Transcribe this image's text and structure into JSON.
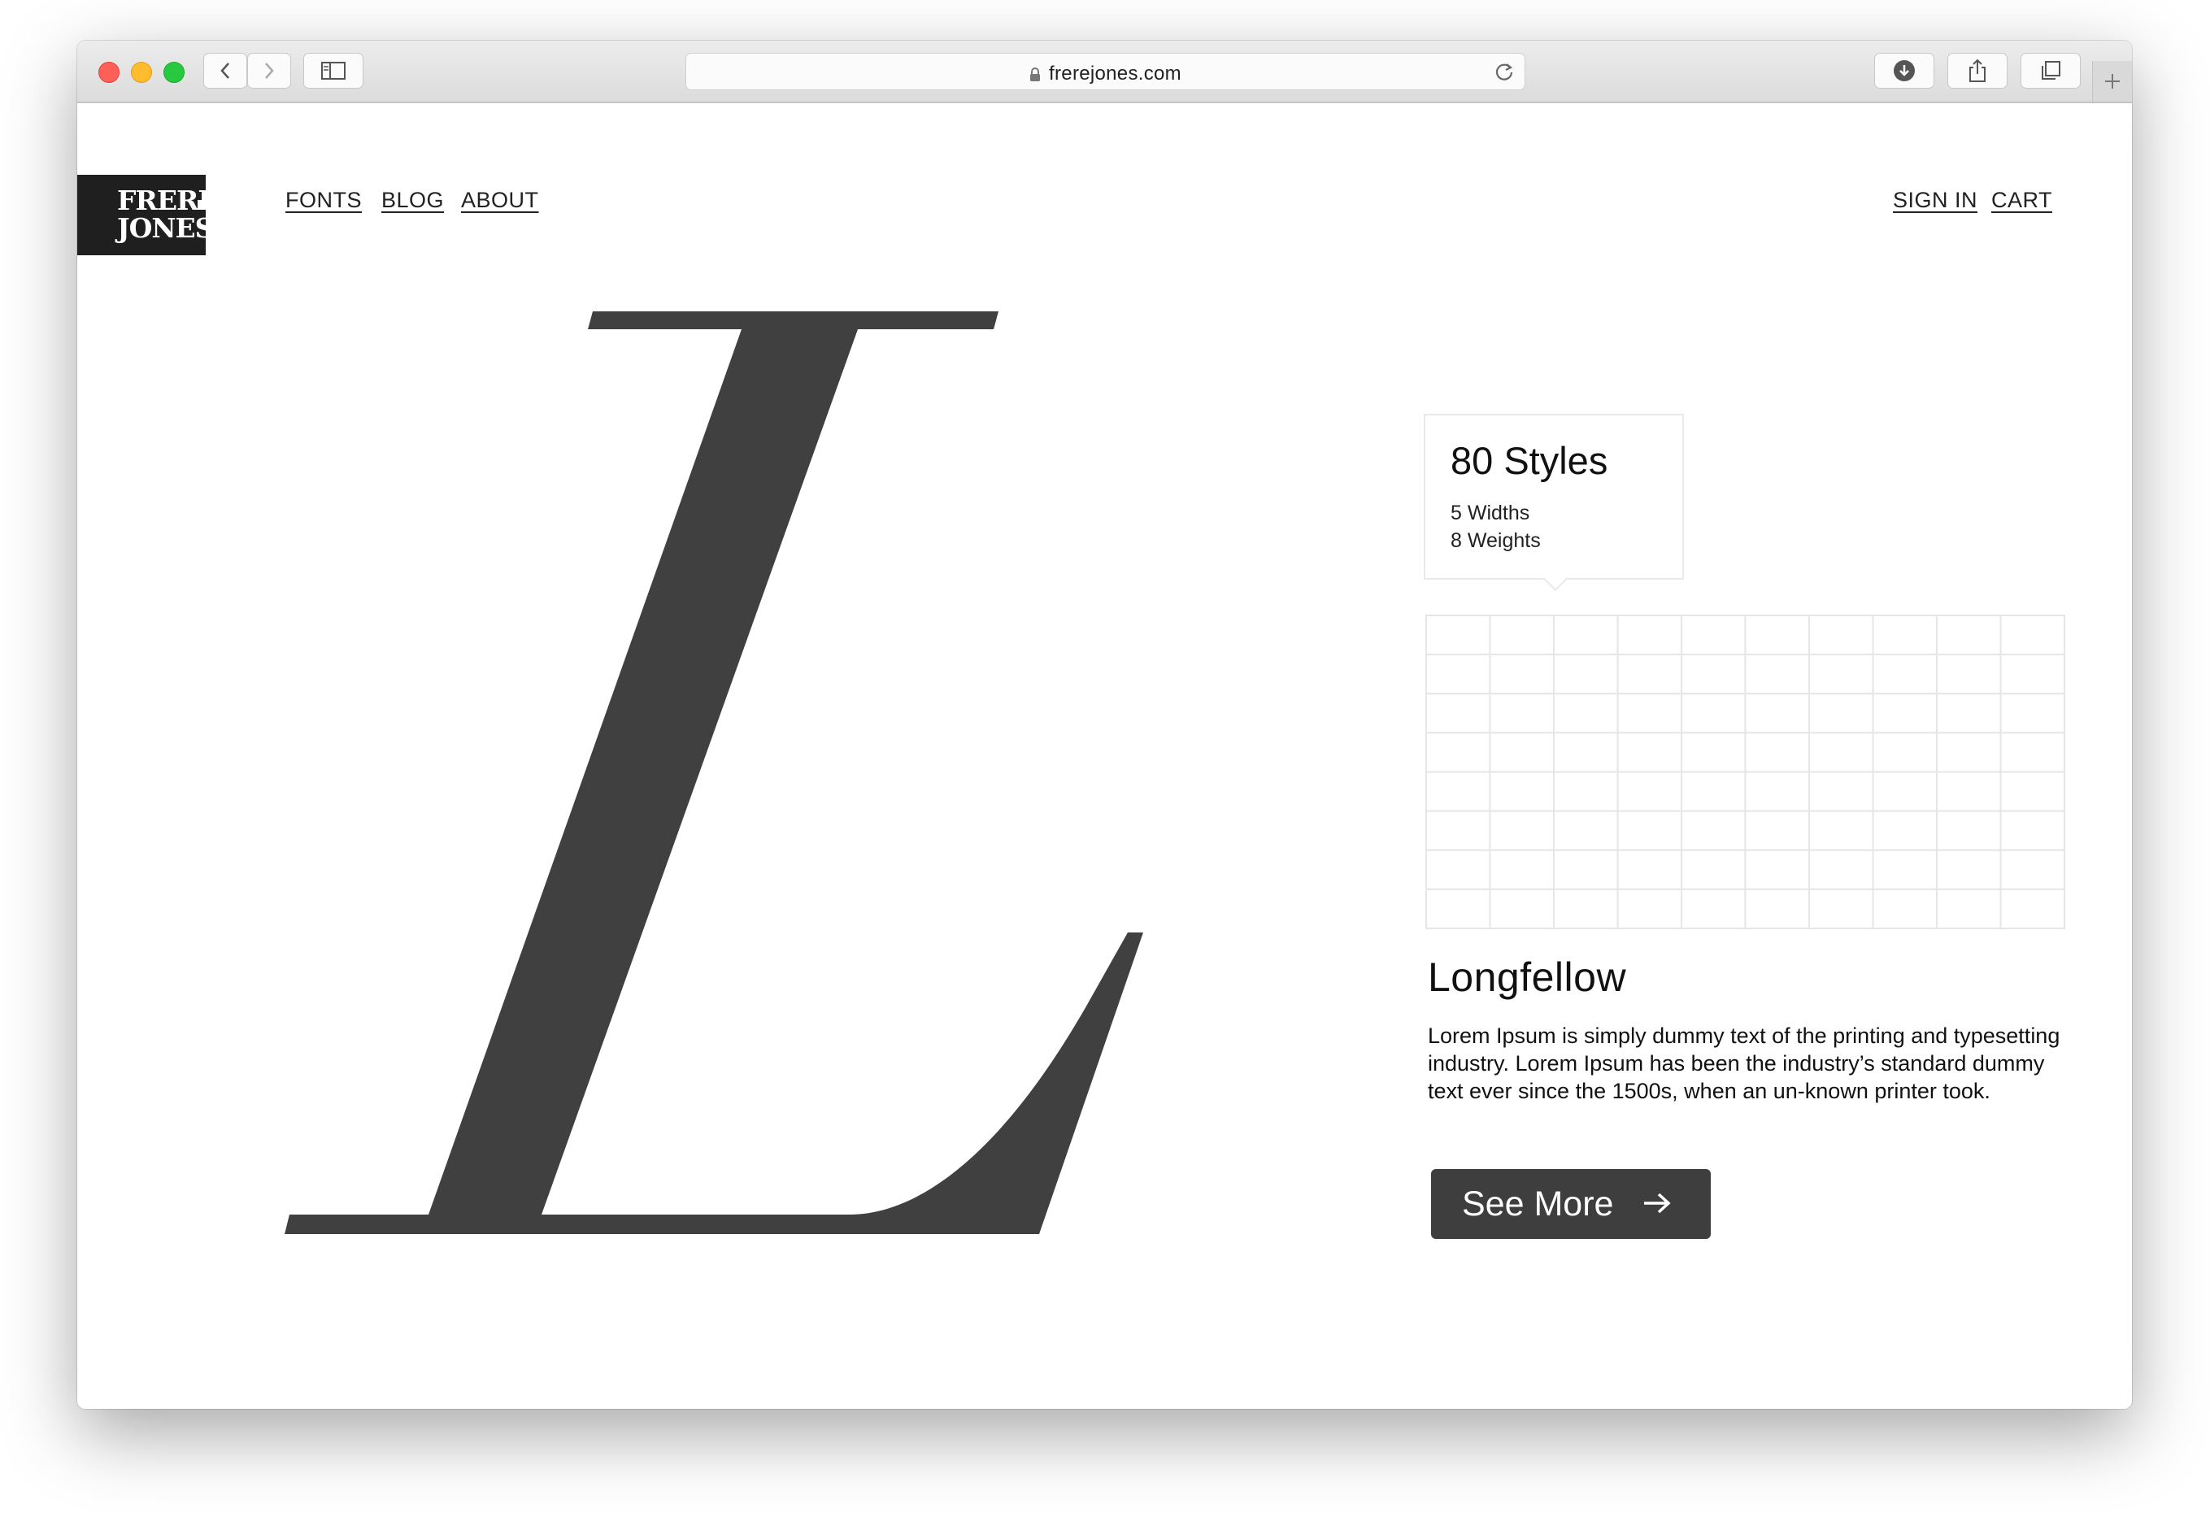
{
  "browser": {
    "url": "frerejones.com"
  },
  "logo": {
    "line1": "FRERE",
    "line2": "JONES"
  },
  "nav": {
    "left": [
      "FONTS",
      "BLOG",
      "ABOUT"
    ],
    "right": [
      "SIGN IN",
      "CART"
    ]
  },
  "hero": {
    "glyph": "L",
    "glyph_color": "#404040"
  },
  "styles_card": {
    "title": "80 Styles",
    "widths": "5 Widths",
    "weights": "8 Weights"
  },
  "font": {
    "name": "Longfellow",
    "description": "Lorem Ipsum is simply dummy text of the printing and typesetting industry. Lorem Ipsum has been the industry’s standard dummy text ever since the 1500s, when an un-known printer took.",
    "button_label": "See More"
  },
  "colors": {
    "button_bg": "#3e3e3e",
    "text": "#111111"
  }
}
